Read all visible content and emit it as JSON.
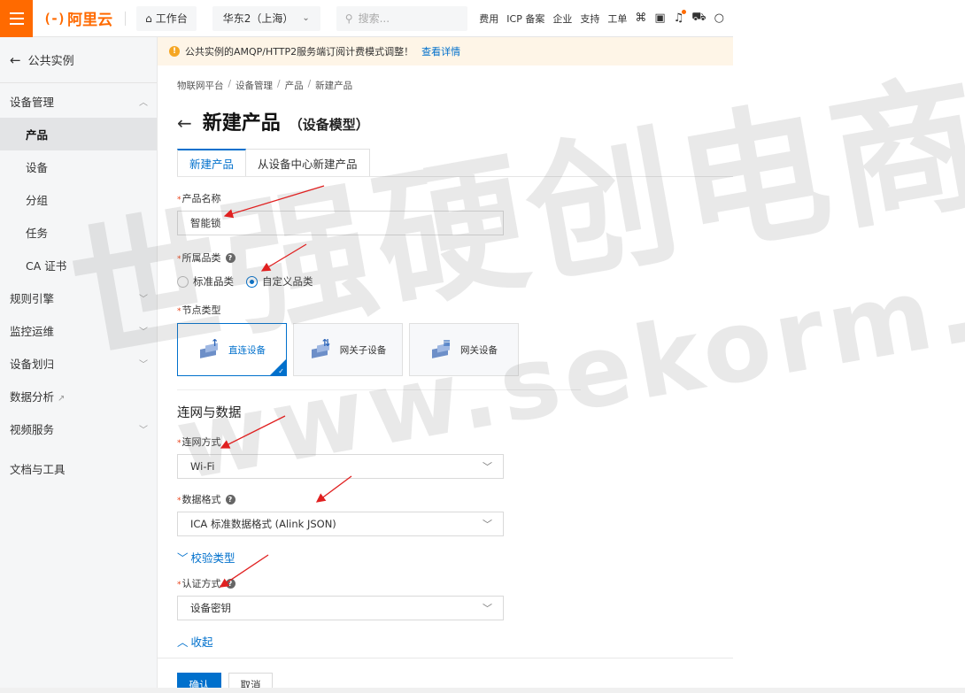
{
  "topbar": {
    "logo_text": "阿里云",
    "logo_mark": "(-)",
    "workbench": "工作台",
    "region": "华东2（上海）",
    "search_placeholder": "搜索...",
    "links": [
      "费用",
      "ICP 备案",
      "企业",
      "支持",
      "工单"
    ],
    "icons": [
      "code-icon",
      "terminal-icon",
      "bell-icon",
      "cart-icon",
      "lightbulb-icon"
    ]
  },
  "sidebar": {
    "back_label": "公共实例",
    "groups": [
      {
        "label": "设备管理",
        "expanded": true,
        "items": [
          "产品",
          "设备",
          "分组",
          "任务",
          "CA 证书"
        ],
        "active": "产品"
      },
      {
        "label": "规则引擎",
        "expanded": false
      },
      {
        "label": "监控运维",
        "expanded": false
      },
      {
        "label": "设备划归",
        "expanded": false
      },
      {
        "label": "数据分析",
        "external": true
      },
      {
        "label": "视频服务",
        "expanded": false
      },
      {
        "label": "文档与工具"
      }
    ]
  },
  "notice": {
    "text": "公共实例的AMQP/HTTP2服务端订阅计费模式调整！",
    "link": "查看详情"
  },
  "breadcrumb": [
    "物联网平台",
    "设备管理",
    "产品",
    "新建产品"
  ],
  "page": {
    "title": "新建产品",
    "subtitle": "（设备模型）"
  },
  "tabs": [
    {
      "label": "新建产品",
      "active": true
    },
    {
      "label": "从设备中心新建产品",
      "active": false
    }
  ],
  "form": {
    "product_name_label": "产品名称",
    "product_name_value": "智能锁",
    "category_label": "所属品类",
    "category_options": [
      {
        "label": "标准品类",
        "checked": false
      },
      {
        "label": "自定义品类",
        "checked": true
      }
    ],
    "node_type_label": "节点类型",
    "node_types": [
      {
        "label": "直连设备",
        "selected": true
      },
      {
        "label": "网关子设备",
        "selected": false
      },
      {
        "label": "网关设备",
        "selected": false
      }
    ],
    "network_section_title": "连网与数据",
    "network_label": "连网方式",
    "network_value": "Wi-Fi",
    "data_format_label": "数据格式",
    "data_format_value": "ICA 标准数据格式 (Alink JSON)",
    "verify_toggle": "校验类型",
    "auth_label": "认证方式",
    "auth_value": "设备密钥",
    "collapse_toggle": "收起"
  },
  "footer": {
    "confirm": "确认",
    "cancel": "取消"
  },
  "watermark": {
    "cn": "世强硬创电商",
    "url": "www.sekorm.com"
  },
  "colors": {
    "brand": "#ff6a00",
    "primary": "#0070cc",
    "required": "#e84118",
    "annotation": "#e02020"
  }
}
